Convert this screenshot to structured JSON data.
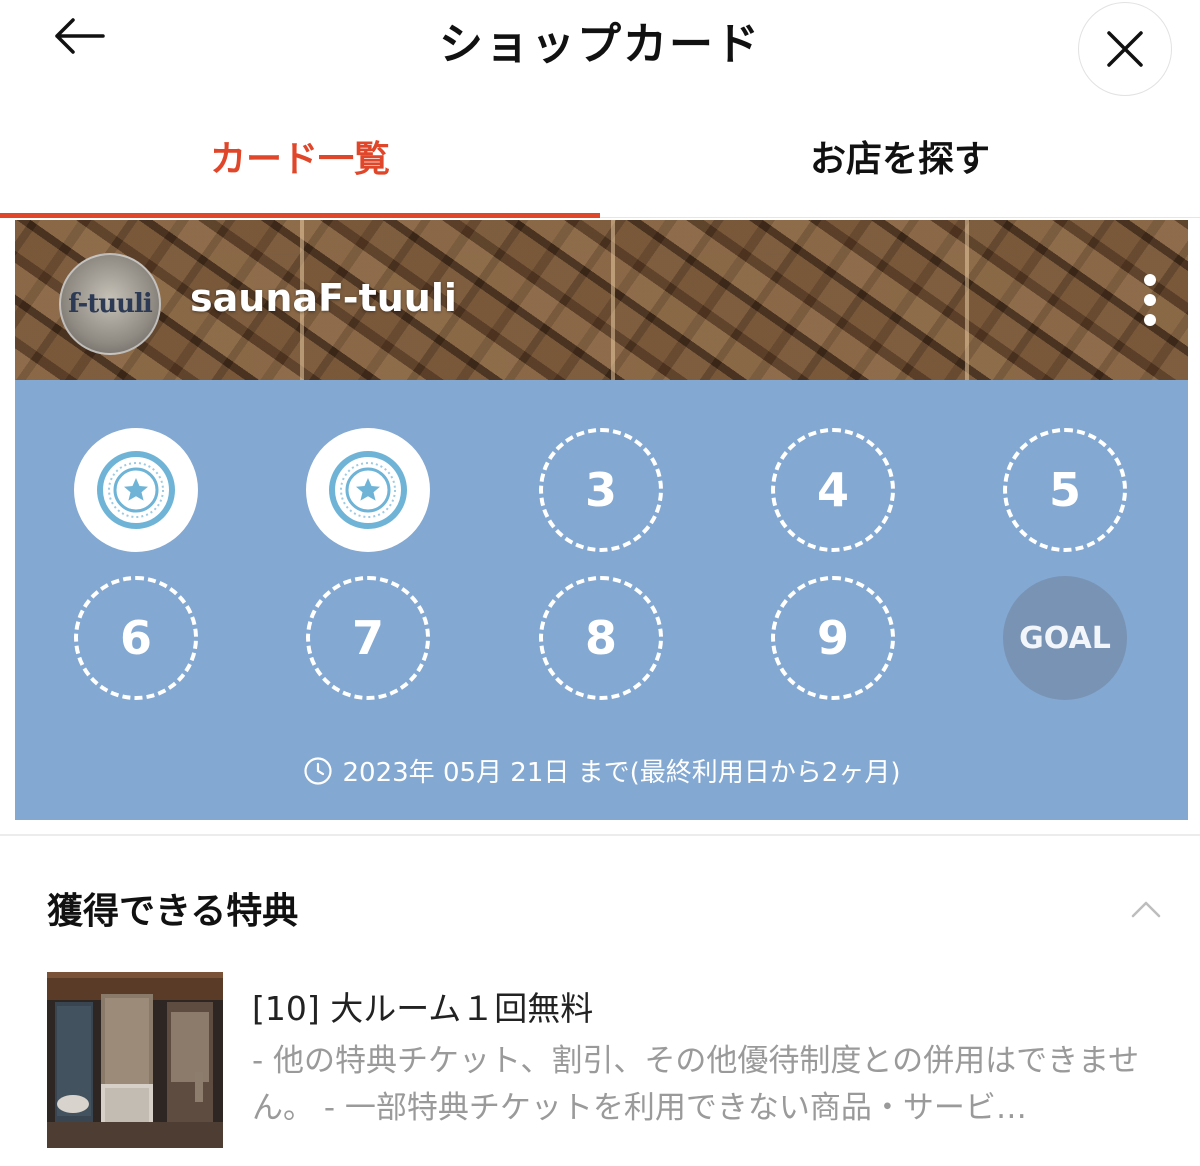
{
  "header": {
    "title": "ショップカード"
  },
  "tabs": [
    {
      "label": "カード一覧",
      "active": true
    },
    {
      "label": "お店を探す",
      "active": false
    }
  ],
  "card": {
    "shop_name": "saunaF-tuuli",
    "logo_text": "f-tuuli",
    "stamps": [
      {
        "label": "",
        "state": "stamped"
      },
      {
        "label": "",
        "state": "stamped"
      },
      {
        "label": "3",
        "state": "empty"
      },
      {
        "label": "4",
        "state": "empty"
      },
      {
        "label": "5",
        "state": "empty"
      },
      {
        "label": "6",
        "state": "empty"
      },
      {
        "label": "7",
        "state": "empty"
      },
      {
        "label": "8",
        "state": "empty"
      },
      {
        "label": "9",
        "state": "empty"
      },
      {
        "label": "GOAL",
        "state": "goal"
      }
    ],
    "expiry": "2023年 05月 21日 まで(最終利用日から2ヶ月)",
    "icons": {
      "more": "more-vertical-icon",
      "clock": "clock-icon",
      "stamp": "star-stamp-icon"
    }
  },
  "rewards": {
    "title": "獲得できる特典",
    "items": [
      {
        "name": "[10] 大ルーム１回無料",
        "description": "- 他の特典チケット、割引、その他優待制度との併用はできません。 - 一部特典チケットを利用できない商品・サービ…"
      }
    ]
  },
  "colors": {
    "accent": "#e0472a",
    "card_background": "#83a8d1",
    "goal_background": "#7993b4",
    "stamp_blue": "#6fb4d6"
  }
}
